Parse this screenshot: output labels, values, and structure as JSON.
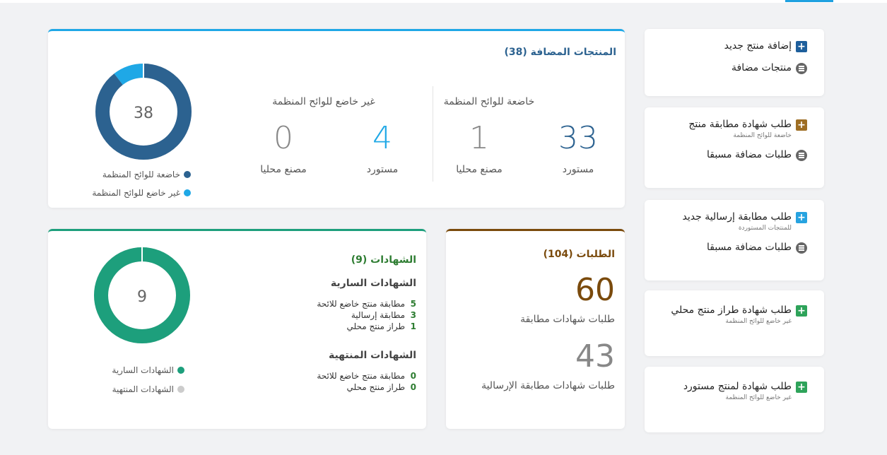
{
  "sidebar": {
    "card1": {
      "add_label": "إضافة منتج جديد",
      "list_label": "منتجات مضافة"
    },
    "card2": {
      "title": "طلب شهادة مطابقة منتج",
      "sub": "خاضعة للوائح المنظمة",
      "list_label": "طلبات مضافة مسبقا"
    },
    "card3": {
      "title": "طلب مطابقة إرسالية جديد",
      "sub": "للمنتجات المستوردة",
      "list_label": "طلبات مضافة مسبقا"
    },
    "card4": {
      "title": "طلب شهادة طراز منتج محلي",
      "sub": "غير خاضع للوائح المنظمة"
    },
    "card5": {
      "title": "طلب شهادة لمنتج مستورد",
      "sub": "غير خاضع للوائح المنظمة"
    }
  },
  "products": {
    "title": "المنتجات المضافة (38)",
    "regulated": {
      "heading": "خاضعة للوائح المنظمة",
      "imported_value": "33",
      "imported_label": "مستورد",
      "local_value": "1",
      "local_label": "مصنع محليا"
    },
    "unregulated": {
      "heading": "غير خاضع للوائح المنظمة",
      "imported_value": "4",
      "imported_label": "مستورد",
      "local_value": "0",
      "local_label": "مصنع محليا"
    },
    "donut_total": "38",
    "legend_regulated": "خاضعة للوائح المنظمة",
    "legend_unregulated": "غير خاضع للوائح المنظمة"
  },
  "requests": {
    "title": "الطلبات (104)",
    "conformity_value": "60",
    "conformity_label": "طلبات شهادات مطابقة",
    "shipment_value": "43",
    "shipment_label": "طلبات شهادات مطابقة الإرسالية"
  },
  "certificates": {
    "title": "الشهادات (9)",
    "active_heading": "الشهادات السارية",
    "active_items": [
      {
        "count": "5",
        "label": "مطابقة منتج خاضع للائحة"
      },
      {
        "count": "3",
        "label": "مطابقة إرسالية"
      },
      {
        "count": "1",
        "label": "طراز منتج محلي"
      }
    ],
    "expired_heading": "الشهادات المنتهية",
    "expired_items": [
      {
        "count": "0",
        "label": "مطابقة منتج خاضع للائحة"
      },
      {
        "count": "0",
        "label": "طراز منتج محلي"
      }
    ],
    "donut_total": "9",
    "legend_active": "الشهادات السارية",
    "legend_expired": "الشهادات المنتهية"
  },
  "colors": {
    "blue_dark": "#2c6290",
    "blue_light": "#1fa8e6",
    "green": "#1d9f7c",
    "brown": "#7a4a0c",
    "gray": "#cccccc",
    "plus_dark_blue": "#1e5f9c",
    "plus_brown": "#9e6e24",
    "plus_light_blue": "#27a3e0",
    "plus_green": "#2ea35a"
  },
  "chart_data": [
    {
      "type": "pie",
      "title": "",
      "categories": [
        "خاضعة للوائح المنظمة",
        "غير خاضع للوائح المنظمة"
      ],
      "values": [
        34,
        4
      ],
      "center_label": "38"
    },
    {
      "type": "pie",
      "title": "",
      "categories": [
        "الشهادات السارية",
        "الشهادات المنتهية"
      ],
      "values": [
        9,
        0
      ],
      "center_label": "9"
    }
  ]
}
